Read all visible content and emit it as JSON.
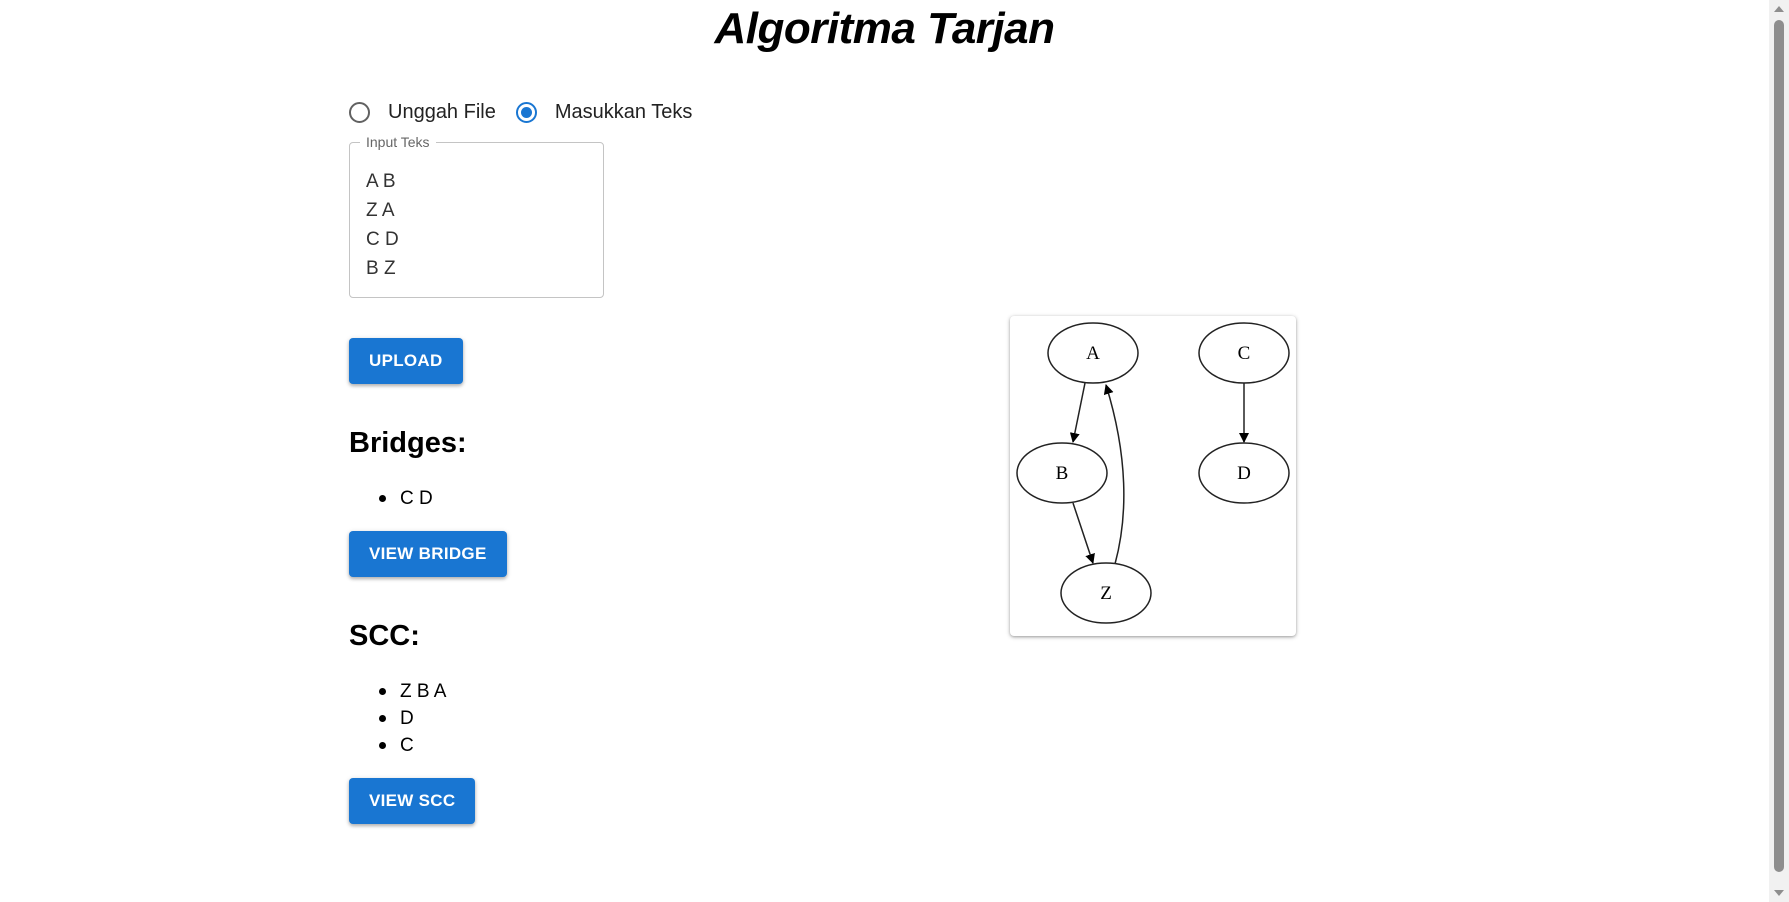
{
  "header": {
    "title": "Algoritma Tarjan"
  },
  "input_mode": {
    "options": [
      {
        "label": "Unggah File",
        "selected": false
      },
      {
        "label": "Masukkan Teks",
        "selected": true
      }
    ]
  },
  "text_input": {
    "label": "Input Teks",
    "value": "A B\nZ A\nC D\nB Z"
  },
  "buttons": {
    "upload": "UPLOAD",
    "view_bridge": "VIEW BRIDGE",
    "view_scc": "VIEW SCC"
  },
  "bridges": {
    "heading": "Bridges:",
    "items": [
      "C D"
    ]
  },
  "scc": {
    "heading": "SCC:",
    "items": [
      "Z B A",
      "D",
      "C"
    ]
  },
  "graph": {
    "nodes": [
      "A",
      "B",
      "Z",
      "C",
      "D"
    ],
    "edges": [
      [
        "A",
        "B"
      ],
      [
        "B",
        "Z"
      ],
      [
        "Z",
        "A"
      ],
      [
        "C",
        "D"
      ]
    ]
  },
  "colors": {
    "accent": "#1976d2",
    "radio_unchecked": "#616161"
  }
}
